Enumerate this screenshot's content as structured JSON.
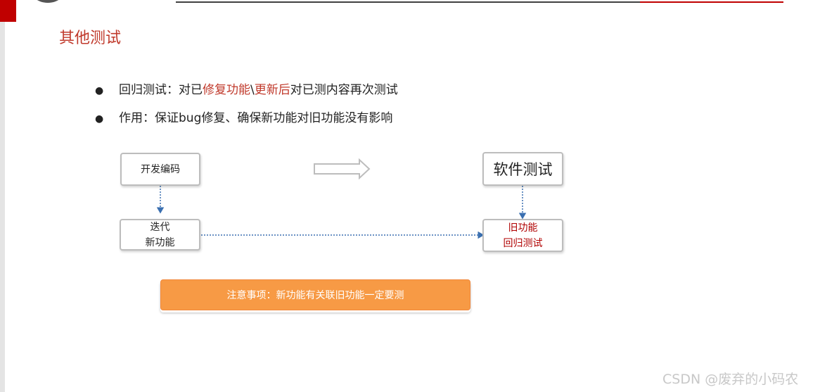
{
  "slide": {
    "title": "其他测试",
    "bullets": [
      {
        "prefix": "回归测试：对已",
        "highlight1": "修复功能",
        "sep": "\\",
        "highlight2": "更新后",
        "suffix": "对已测内容再次测试"
      },
      {
        "text": "作用：保证bug修复、确保新功能对旧功能没有影响"
      }
    ],
    "bullet_symbol": "●"
  },
  "diagram": {
    "dev_box": "开发编码",
    "iterate_line1": "迭代",
    "iterate_line2": "新功能",
    "test_box": "软件测试",
    "regress_line1": "旧功能",
    "regress_line2": "回归测试",
    "note": "注意事项：新功能有关联旧功能一定要测"
  },
  "colors": {
    "accent_red": "#c0392b",
    "note_orange": "#f79a45",
    "arrow_blue": "#3a6fb0"
  },
  "watermark": "CSDN @废弃的小码农"
}
